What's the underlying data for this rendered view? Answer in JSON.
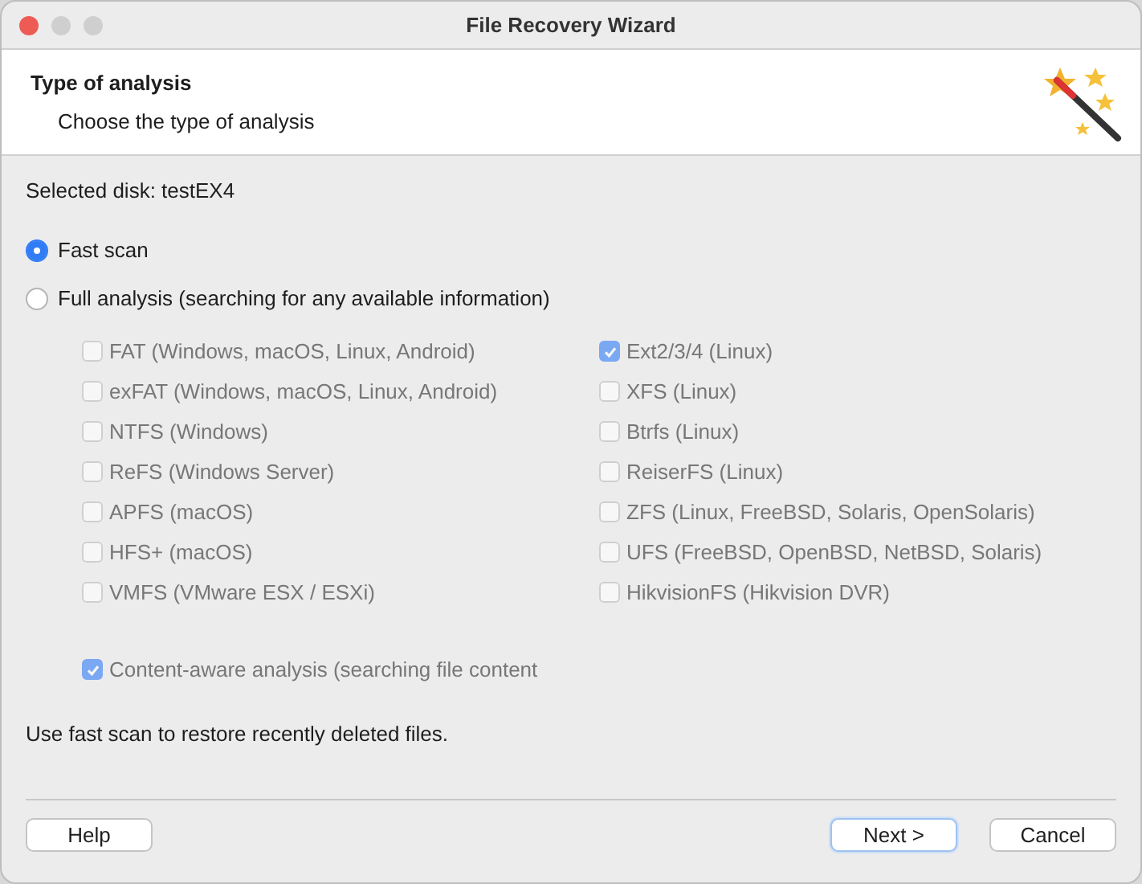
{
  "window": {
    "title": "File Recovery Wizard"
  },
  "header": {
    "title": "Type of analysis",
    "subtitle": "Choose the type of analysis"
  },
  "selected_disk": "Selected disk: testEX4",
  "scan_options": [
    {
      "label": "Fast scan",
      "selected": true
    },
    {
      "label": "Full analysis (searching for any available information)",
      "selected": false
    }
  ],
  "filesystems_left": [
    {
      "label": "FAT (Windows, macOS, Linux, Android)",
      "checked": false,
      "disabled": true
    },
    {
      "label": "exFAT (Windows, macOS, Linux, Android)",
      "checked": false,
      "disabled": true
    },
    {
      "label": "NTFS (Windows)",
      "checked": false,
      "disabled": true
    },
    {
      "label": "ReFS (Windows Server)",
      "checked": false,
      "disabled": true
    },
    {
      "label": "APFS (macOS)",
      "checked": false,
      "disabled": true
    },
    {
      "label": "HFS+ (macOS)",
      "checked": false,
      "disabled": true
    },
    {
      "label": "VMFS (VMware ESX / ESXi)",
      "checked": false,
      "disabled": true
    }
  ],
  "filesystems_right": [
    {
      "label": "Ext2/3/4 (Linux)",
      "checked": true,
      "disabled": true
    },
    {
      "label": "XFS (Linux)",
      "checked": false,
      "disabled": true
    },
    {
      "label": "Btrfs (Linux)",
      "checked": false,
      "disabled": true
    },
    {
      "label": "ReiserFS (Linux)",
      "checked": false,
      "disabled": true
    },
    {
      "label": "ZFS (Linux, FreeBSD, Solaris, OpenSolaris)",
      "checked": false,
      "disabled": true
    },
    {
      "label": "UFS (FreeBSD, OpenBSD, NetBSD, Solaris)",
      "checked": false,
      "disabled": true
    },
    {
      "label": "HikvisionFS (Hikvision DVR)",
      "checked": false,
      "disabled": true
    }
  ],
  "content_aware": {
    "label": "Content-aware analysis (searching file content",
    "checked": true,
    "disabled": true
  },
  "hint": "Use fast scan to restore recently deleted files.",
  "buttons": {
    "help": "Help",
    "next": "Next >",
    "cancel": "Cancel"
  }
}
